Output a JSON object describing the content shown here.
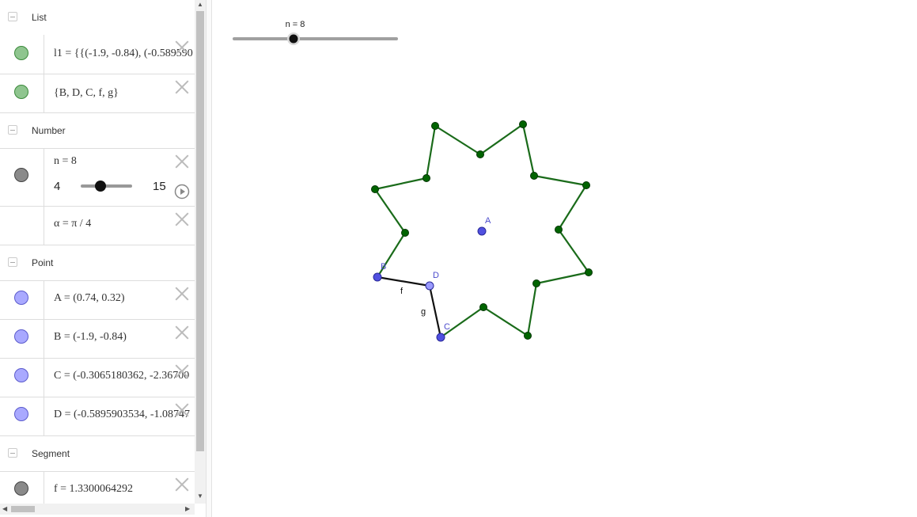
{
  "algebra": {
    "groups": {
      "list": "List",
      "number": "Number",
      "point": "Point",
      "segment": "Segment"
    },
    "rows": {
      "l1": "l1 = {{(-1.9, -0.84), (-0.5895903534",
      "set": "{B, D, C, f, g}",
      "n": "n = 8",
      "n_min": "4",
      "n_max": "15",
      "n_value": 8,
      "alpha": "α = π / 4",
      "A": "A = (0.74, 0.32)",
      "B": "B = (-1.9, -0.84)",
      "C": "C = (-0.3065180362, -2.36700",
      "D": "D = (-0.5895903534, -1.08747",
      "f": "f = 1.3300064292"
    }
  },
  "graphics": {
    "slider_label": "n = 8",
    "labels": {
      "A": "A",
      "B": "B",
      "C": "C",
      "D": "D",
      "f": "f",
      "g": "g"
    }
  },
  "colors": {
    "green_marble": "#8fc58f",
    "gray_marble": "#8a8a8a",
    "blue_marble": "#a9a9ff",
    "star_line": "#1a6b1a",
    "star_point": "#006400",
    "blue_point": "#5050e0",
    "label_blue": "#4b4bcc"
  }
}
